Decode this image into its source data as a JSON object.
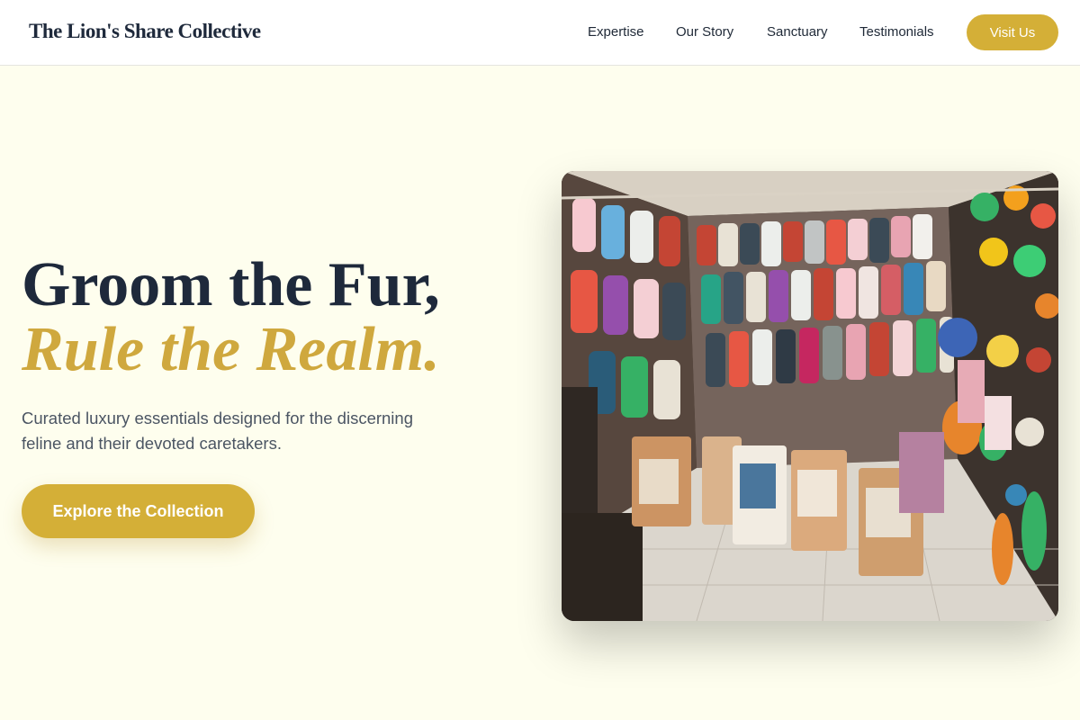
{
  "header": {
    "brand": "The Lion's Share Collective",
    "nav": [
      "Expertise",
      "Our Story",
      "Sanctuary",
      "Testimonials"
    ],
    "cta_label": "Visit Us"
  },
  "hero": {
    "title_line1": "Groom the Fur,",
    "title_line2": "Rule the Realm.",
    "subtitle": "Curated luxury essentials designed for the discerning feline and their devoted caretakers.",
    "cta_label": "Explore the Collection"
  },
  "image": {
    "description_icon": "photo-icon"
  },
  "colors": {
    "accent": "#d4af37",
    "background": "#fefeee",
    "heading": "#1e293b",
    "body_text": "#4b5563"
  }
}
